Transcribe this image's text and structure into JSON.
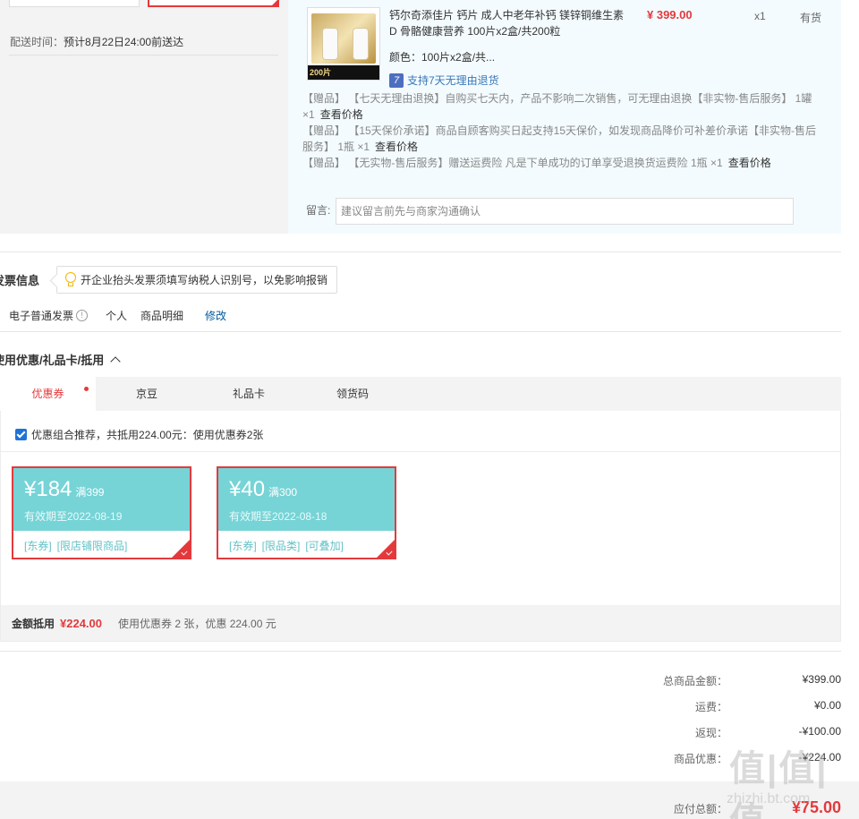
{
  "shipping": {
    "label": "配送时间：",
    "value": "预计8月22日24:00前送达"
  },
  "product": {
    "name": "钙尔奇添佳片 钙片 成人中老年补钙 镁锌铜维生素D 骨骼健康营养 100片x2盒/共200粒",
    "image_strip": "200片",
    "price": "¥ 399.00",
    "qty": "x1",
    "stock": "有货",
    "color": "颜色：100片x2盒/共...",
    "return_icon": "7",
    "return_text": "支持7天无理由退货",
    "gifts": [
      {
        "text": "【赠品】 【七天无理由退换】自购买七天内，产品不影响二次销售，可无理由退换【非实物-售后服务】 1罐 ×1",
        "link": "查看价格"
      },
      {
        "text": "【赠品】 【15天保价承诺】商品自顾客购买日起支持15天保价，如发现商品降价可补差价承诺【非实物-售后服务】 1瓶 ×1",
        "link": "查看价格"
      },
      {
        "text": "【赠品】 【无实物-售后服务】赠送运费险 凡是下单成功的订单享受退换货运费险 1瓶 ×1",
        "link": "查看价格"
      }
    ],
    "note_label": "留言:",
    "note_placeholder": "建议留言前先与商家沟通确认"
  },
  "invoice": {
    "title": "发票信息",
    "tip": "开企业抬头发票须填写纳税人识别号，以免影响报销",
    "type": "电子普通发票",
    "person": "个人",
    "detail": "商品明细",
    "edit": "修改"
  },
  "coupon_section": {
    "title": "使用优惠/礼品卡/抵用",
    "tabs": [
      "优惠券",
      "京豆",
      "礼品卡",
      "领货码"
    ],
    "combo_text": "优惠组合推荐，共抵用224.00元：使用优惠券2张",
    "coupons": [
      {
        "amount": "¥184",
        "condition": "满399",
        "valid": "有效期至2022-08-19",
        "tags": [
          "[东券]",
          "[限店铺限商品]"
        ]
      },
      {
        "amount": "¥40",
        "condition": "满300",
        "valid": "有效期至2022-08-18",
        "tags": [
          "[东券]",
          "[限品类]",
          "[可叠加]"
        ]
      }
    ],
    "summary_label": "金额抵用",
    "summary_amount": "¥224.00",
    "summary_desc": "使用优惠券 2 张，优惠 224.00 元"
  },
  "totals": {
    "rows": [
      {
        "label": "总商品金额：",
        "value": "¥399.00"
      },
      {
        "label": "运费：",
        "value": "¥0.00"
      },
      {
        "label": "返现：",
        "value": "-¥100.00"
      },
      {
        "label": "商品优惠：",
        "value": "-¥224.00"
      }
    ],
    "pay_label": "应付总额：",
    "pay_value": "¥75.00"
  },
  "watermark": {
    "logo": "值|值|值",
    "url": "zhizhi.bt.com"
  },
  "colors": {
    "accent_red": "#e4393c",
    "coupon_teal": "#76d3d6",
    "link_blue": "#005aa0"
  }
}
